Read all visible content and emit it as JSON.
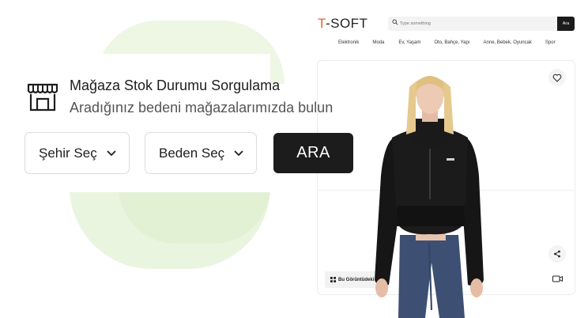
{
  "shop": {
    "logo_prefix": "T",
    "logo_suffix": "-SOFT",
    "accent_color": "#e8642c",
    "search_placeholder": "Type something",
    "search_button": "Ara",
    "nav": [
      "Elektronik",
      "Moda",
      "Ev, Yaşam",
      "Oto, Bahçe, Yapı",
      "Anne, Bebek, Oyuncak",
      "Spor"
    ],
    "chip_label": "Bu Görüntüdeki",
    "icons": [
      "heart-icon",
      "share-icon",
      "video-icon",
      "grid-icon",
      "search-icon"
    ]
  },
  "widget": {
    "title": "Mağaza Stok Durumu Sorgulama",
    "subtitle": "Aradığınız bedeni mağazalarımızda bulun",
    "city_select": "Şehir Seç",
    "size_select": "Beden Seç",
    "search_button": "ARA",
    "icon": "store-icon"
  }
}
